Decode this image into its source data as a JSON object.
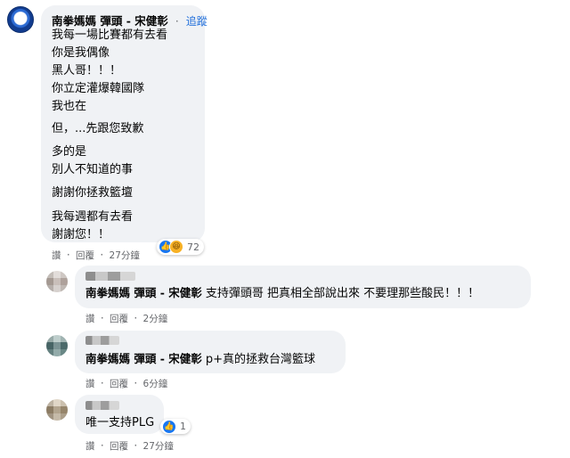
{
  "comments": [
    {
      "author": "南拳媽媽 彈頭 - 宋健彰",
      "follow_label": "追蹤",
      "lines": [
        "我每一場比賽都有去看",
        "你是我偶像",
        "黑人哥！！！",
        "你立定灌爆韓國隊",
        "我也在",
        "但，...先跟您致歉",
        "多的是",
        "別人不知道的事",
        "謝謝你拯救籃壇",
        "我每週都有去看",
        "謝謝您！！"
      ],
      "reaction_count": "72",
      "actions": {
        "like": "讚",
        "reply": "回覆",
        "time": "27分鐘"
      }
    }
  ],
  "replies": [
    {
      "mention": "南拳媽媽 彈頭 - 宋健彰",
      "text": "支持彈頭哥 把真相全部說出來 不要理那些酸民！！！",
      "actions": {
        "like": "讚",
        "reply": "回覆",
        "time": "2分鐘"
      }
    },
    {
      "mention": "南拳媽媽 彈頭 - 宋健彰",
      "text": "p+真的拯救台灣籃球",
      "actions": {
        "like": "讚",
        "reply": "回覆",
        "time": "6分鐘"
      }
    },
    {
      "text": "唯一支持PLG",
      "reaction_count": "1",
      "actions": {
        "like": "讚",
        "reply": "回覆",
        "time": "27分鐘"
      }
    }
  ],
  "separator": "·",
  "icons": [
    "like-reaction-icon",
    "haha-reaction-icon"
  ],
  "colors": {
    "bubble": "#f0f2f5",
    "link": "#216fdb",
    "meta": "#65676b",
    "like": "#1877f2"
  }
}
